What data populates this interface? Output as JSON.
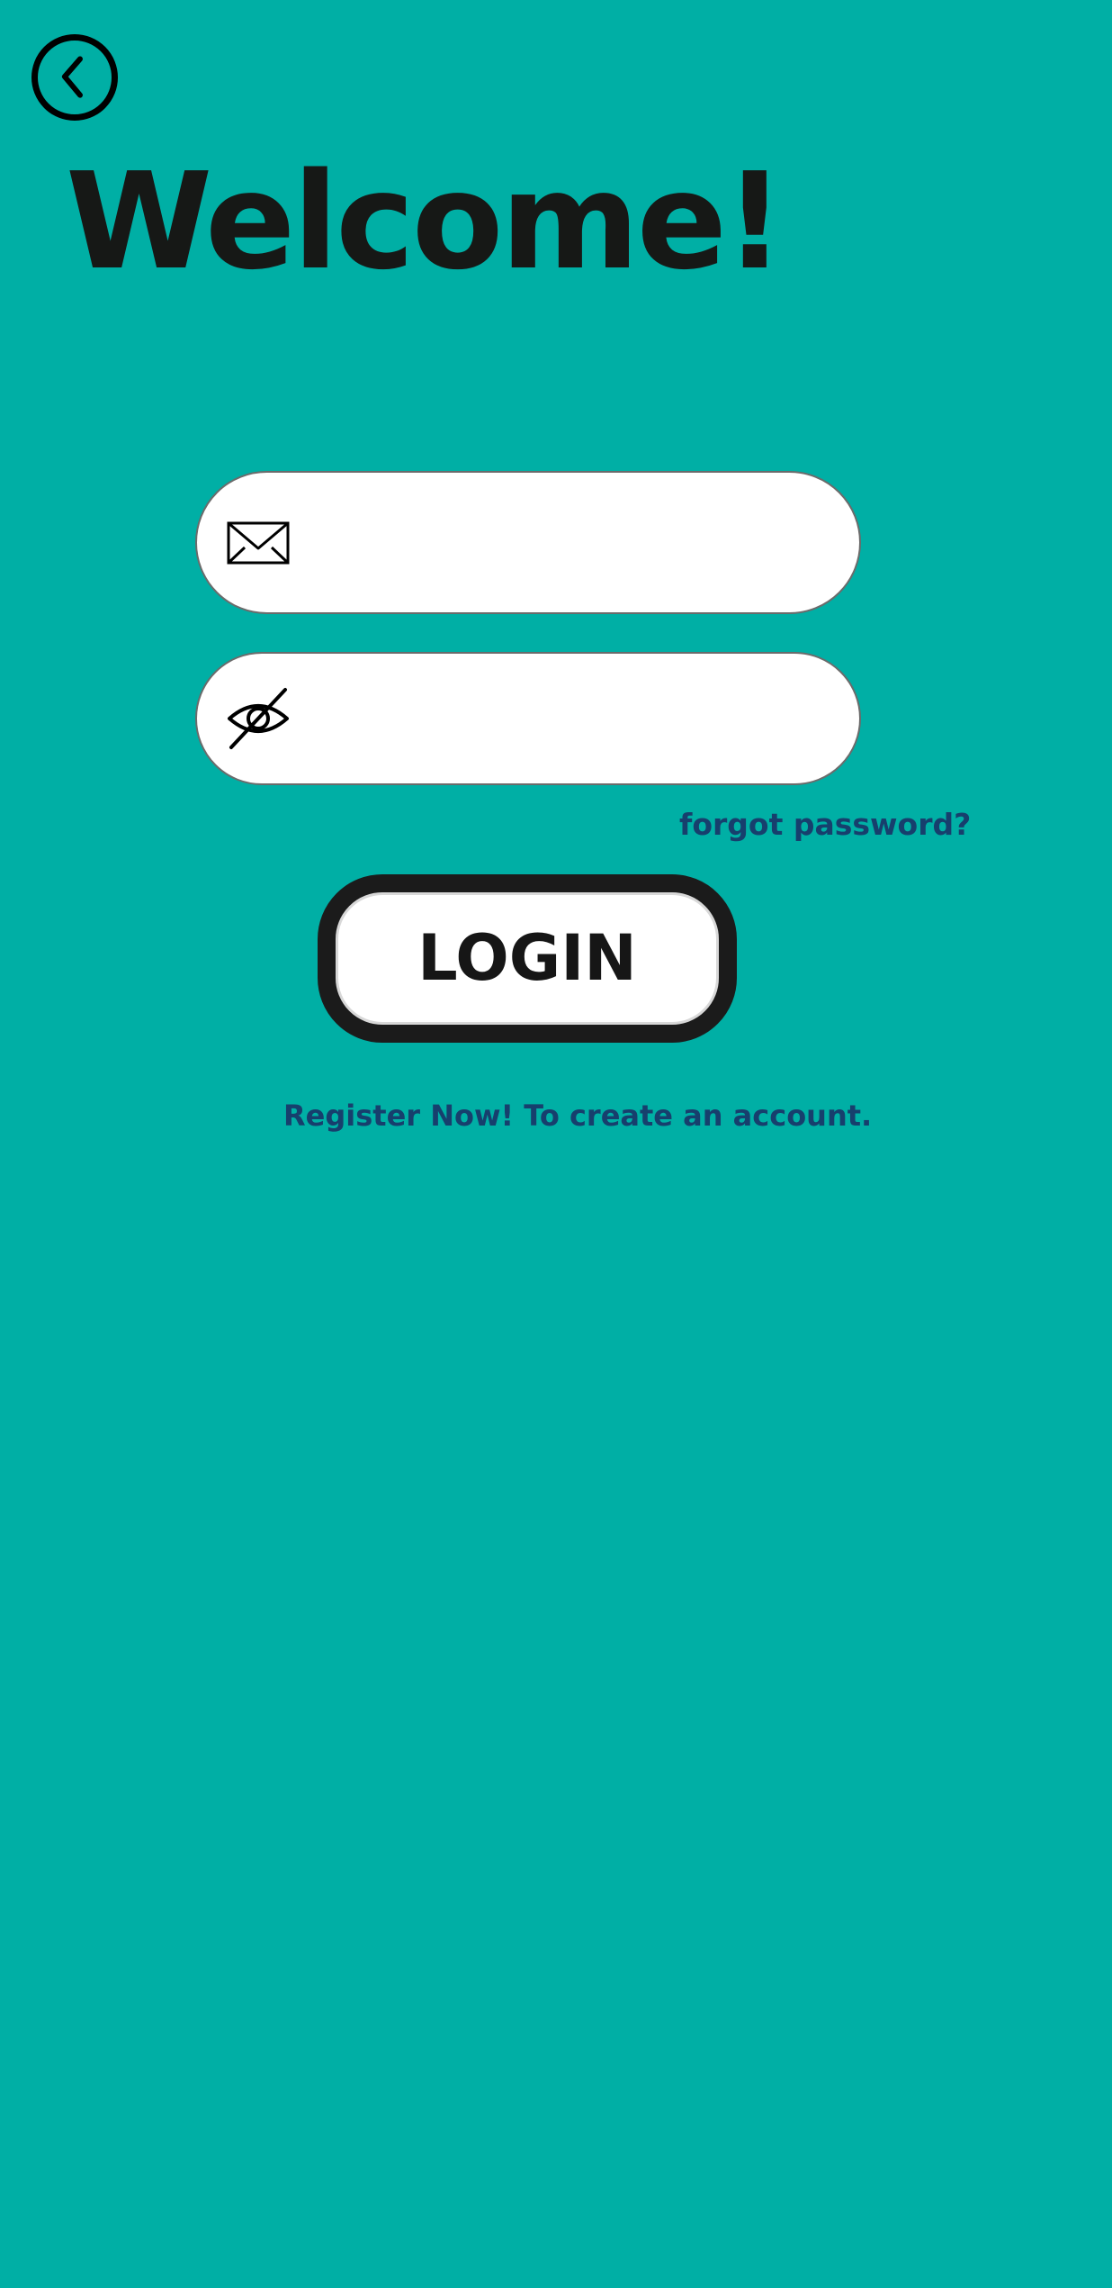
{
  "header": {
    "back_icon": "chevron-left-circle-icon"
  },
  "title": "Welcome!",
  "form": {
    "email": {
      "icon": "envelope-icon",
      "value": "",
      "placeholder": ""
    },
    "password": {
      "icon": "eye-slash-icon",
      "value": "",
      "placeholder": ""
    },
    "forgot_label": "forgot password?",
    "login_label": "LOGIN",
    "register_label": "Register Now! To create an account."
  },
  "colors": {
    "background": "#00AFA5",
    "link": "#173F6D",
    "title": "#161816",
    "button_border": "#1B1B1B"
  }
}
